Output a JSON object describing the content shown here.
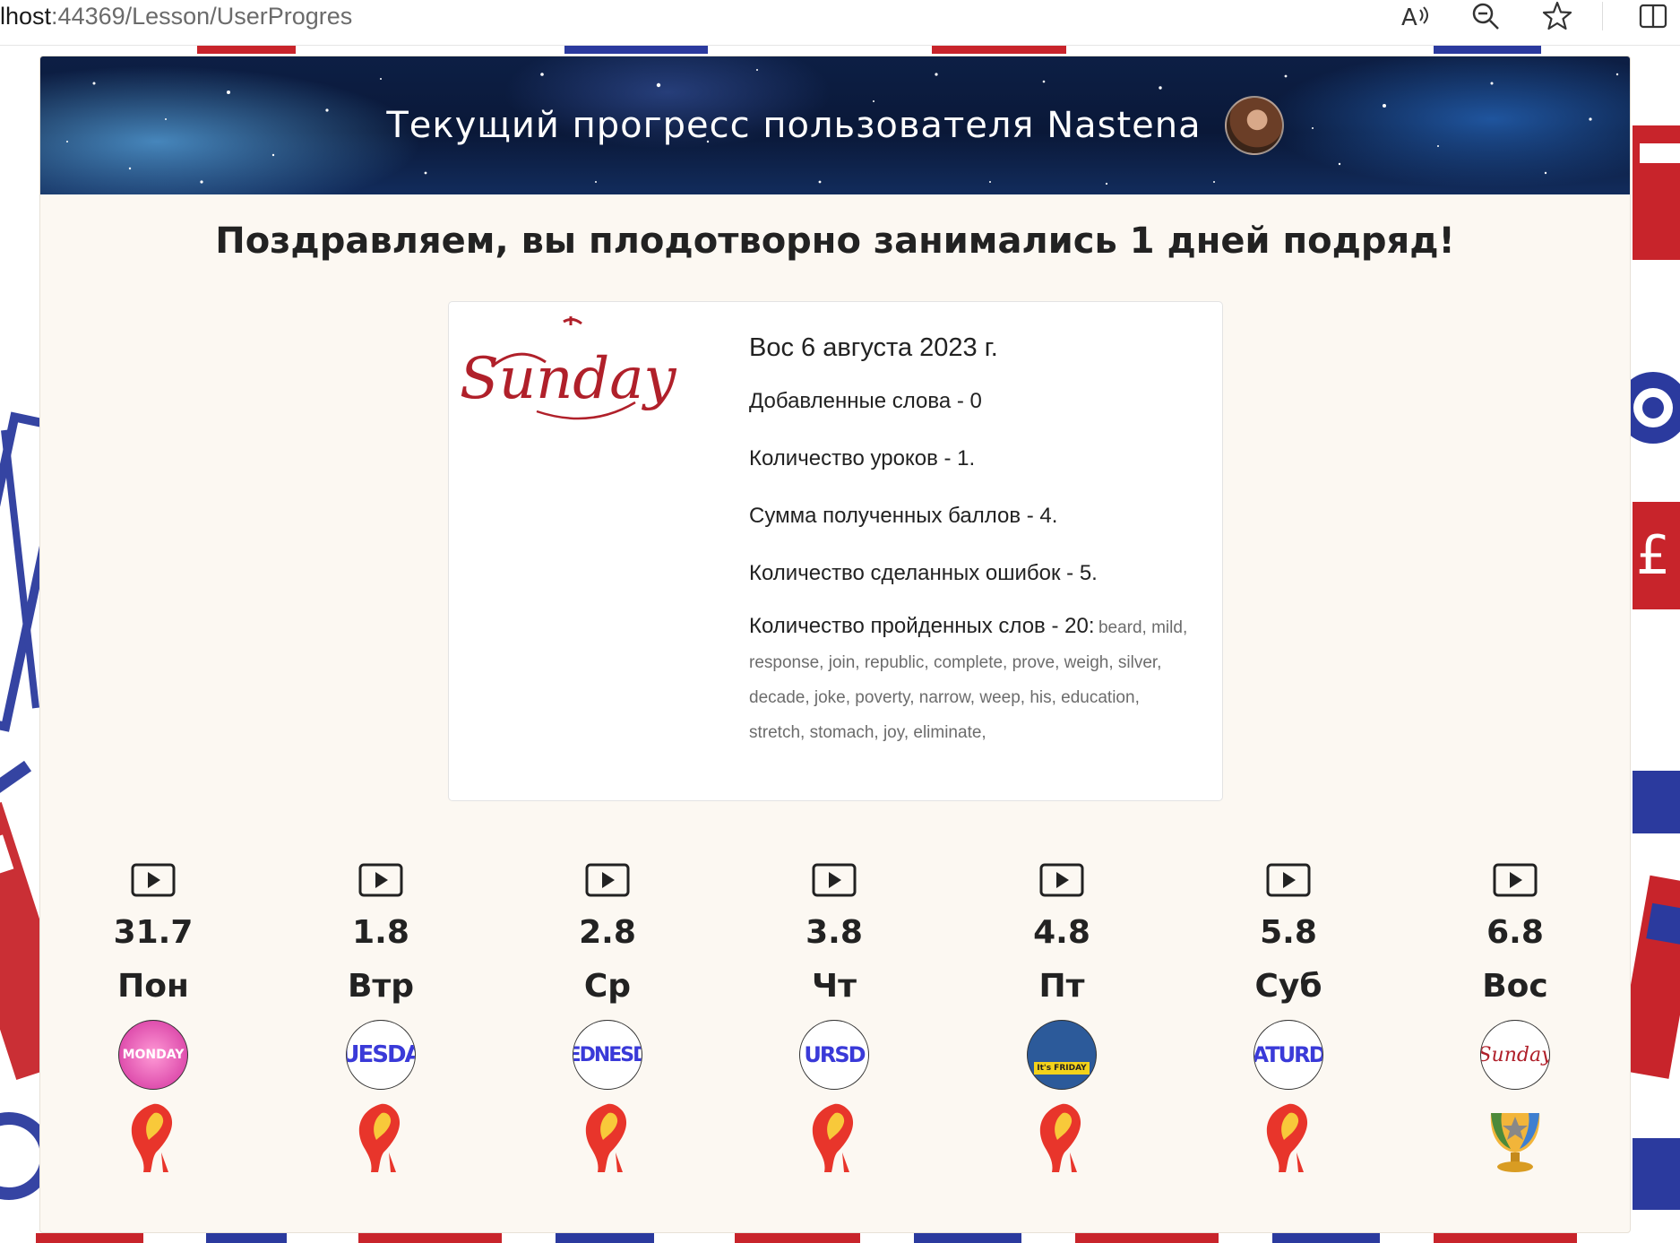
{
  "browser": {
    "url_host": "lhost",
    "url_rest": ":44369/Lesson/UserProgres",
    "icons": [
      "read-aloud-icon",
      "zoom-out-icon",
      "favorite-star-icon",
      "split-screen-icon"
    ]
  },
  "header": {
    "title": "Текущий прогресс пользователя Nastena"
  },
  "congrats": "Поздравляем, вы плодотворно занимались 1 дней подряд!",
  "selected_day": {
    "logo_text": "Sunday",
    "date": "Вос 6 августа 2023 г.",
    "added_words": "Добавленные слова - 0",
    "lessons": "Количество уроков - 1.",
    "points": "Сумма полученных баллов - 4.",
    "mistakes": "Количество сделанных ошибок - 5.",
    "passed_words_label": "Количество пройденных слов - 20:",
    "passed_words": "beard, mild, response, join, republic, complete, prove, weigh, silver, decade, joke, poverty, narrow, weep, his, education, stretch, stomach, joy, eliminate,"
  },
  "week": [
    {
      "date": "31.7",
      "name": "Пон",
      "badge": "MONDAY",
      "status": "flame-icon"
    },
    {
      "date": "1.8",
      "name": "Втр",
      "badge": "UESDA",
      "status": "flame-icon"
    },
    {
      "date": "2.8",
      "name": "Ср",
      "badge": "EDNESD",
      "status": "flame-icon"
    },
    {
      "date": "3.8",
      "name": "Чт",
      "badge": "URSD",
      "status": "flame-icon"
    },
    {
      "date": "4.8",
      "name": "Пт",
      "badge": "It's FRIDAY",
      "status": "flame-icon"
    },
    {
      "date": "5.8",
      "name": "Суб",
      "badge": "ATURD",
      "status": "flame-icon"
    },
    {
      "date": "6.8",
      "name": "Вос",
      "badge": "Sunday",
      "status": "trophy-icon"
    }
  ],
  "colors": {
    "page_bg": "#fcf8f2",
    "banner_bg": "#0d1f45",
    "flame": "#e8352b",
    "flame_core": "#f8c93a",
    "sunday_red": "#b0202a",
    "weekday_blue": "#3a3ad8"
  }
}
